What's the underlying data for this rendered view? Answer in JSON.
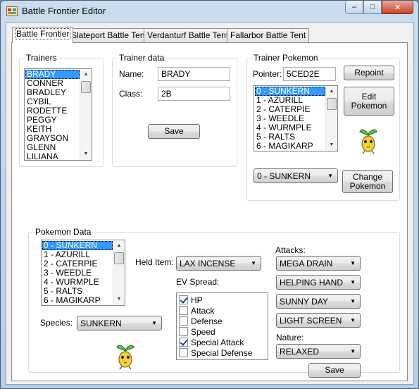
{
  "window": {
    "title": "Battle Frontier Editor",
    "controls": {
      "minimize": "–",
      "maximize": "□",
      "close": "✕"
    }
  },
  "tabs": [
    "Battle Frontier",
    "Slateport Battle Tent",
    "Verdanturf Battle Tent",
    "Fallarbor Battle Tent"
  ],
  "trainers": {
    "title": "Trainers",
    "items": [
      "BRADY",
      "CONNER",
      "BRADLEY",
      "CYBIL",
      "RODETTE",
      "PEGGY",
      "KEITH",
      "GRAYSON",
      "GLENN",
      "LILIANA"
    ],
    "selected_index": 0
  },
  "trainer_data": {
    "title": "Trainer data",
    "name_label": "Name:",
    "name_value": "BRADY",
    "class_label": "Class:",
    "class_value": "2B",
    "save_label": "Save"
  },
  "trainer_pokemon": {
    "title": "Trainer Pokemon",
    "pointer_label": "Pointer:",
    "pointer_value": "5CED2E",
    "repoint_label": "Repoint",
    "edit_label": "Edit\nPokemon",
    "items": [
      "0 - SUNKERN",
      "1 - AZURILL",
      "2 - CATERPIE",
      "3 - WEEDLE",
      "4 - WURMPLE",
      "5 - RALTS",
      "6 - MAGIKARP"
    ],
    "selected_index": 0,
    "combo_value": "0 - SUNKERN",
    "change_label": "Change\nPokemon",
    "sprite_icon": "sunkern-sprite-icon"
  },
  "pokemon_data": {
    "title": "Pokemon Data",
    "items": [
      "0 - SUNKERN",
      "1 - AZURILL",
      "2 - CATERPIE",
      "3 - WEEDLE",
      "4 - WURMPLE",
      "5 - RALTS",
      "6 - MAGIKARP"
    ],
    "selected_index": 0,
    "species_label": "Species:",
    "species_value": "SUNKERN",
    "held_item_label": "Held Item:",
    "held_item_value": "LAX INCENSE",
    "ev_label": "EV Spread:",
    "ev_options": [
      {
        "label": "HP",
        "checked": true
      },
      {
        "label": "Attack",
        "checked": false
      },
      {
        "label": "Defense",
        "checked": false
      },
      {
        "label": "Speed",
        "checked": false
      },
      {
        "label": "Special Attack",
        "checked": true
      },
      {
        "label": "Special Defense",
        "checked": false
      }
    ],
    "attacks_label": "Attacks:",
    "attacks": [
      "MEGA DRAIN",
      "HELPING HAND",
      "SUNNY DAY",
      "LIGHT SCREEN"
    ],
    "nature_label": "Nature:",
    "nature_value": "RELAXED",
    "save_label": "Save"
  },
  "colors": {
    "selection": "#3399ff",
    "title_bar": "#c9dcee",
    "close_button": "#c7462c"
  }
}
